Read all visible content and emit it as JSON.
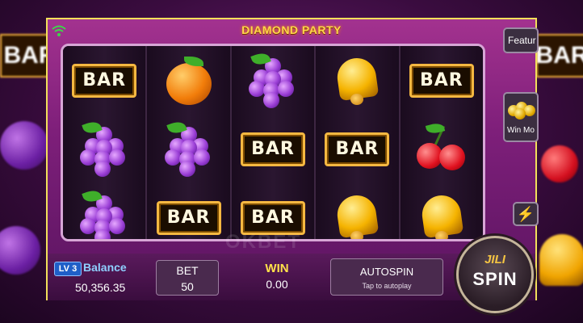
{
  "game": {
    "title": "DIAMOND PARTY",
    "watermark": "OKBET"
  },
  "reels": [
    [
      "bar",
      "grape",
      "grape"
    ],
    [
      "orange",
      "grape",
      "bar"
    ],
    [
      "grape",
      "bar",
      "bar"
    ],
    [
      "bell",
      "bar",
      "bell"
    ],
    [
      "bar",
      "cherry",
      "bell"
    ]
  ],
  "symbols": {
    "bar_text": "BAR"
  },
  "side": {
    "feature_label": "Featur",
    "win_more_label": "Win Mo",
    "turbo_icon": "lightning-icon"
  },
  "player": {
    "level": "LV 3",
    "balance_label": "Balance",
    "balance_value": "50,356.35"
  },
  "bet": {
    "label": "BET",
    "value": "50"
  },
  "win": {
    "label": "WIN",
    "value": "0.00"
  },
  "autospin": {
    "label": "AUTOSPIN",
    "sub": "Tap to autoplay"
  },
  "spin": {
    "brand": "JILI",
    "label": "SPIN"
  },
  "colors": {
    "accent": "#f2e05a",
    "gold": "#f5b841",
    "panel": "#7e1f7a"
  }
}
